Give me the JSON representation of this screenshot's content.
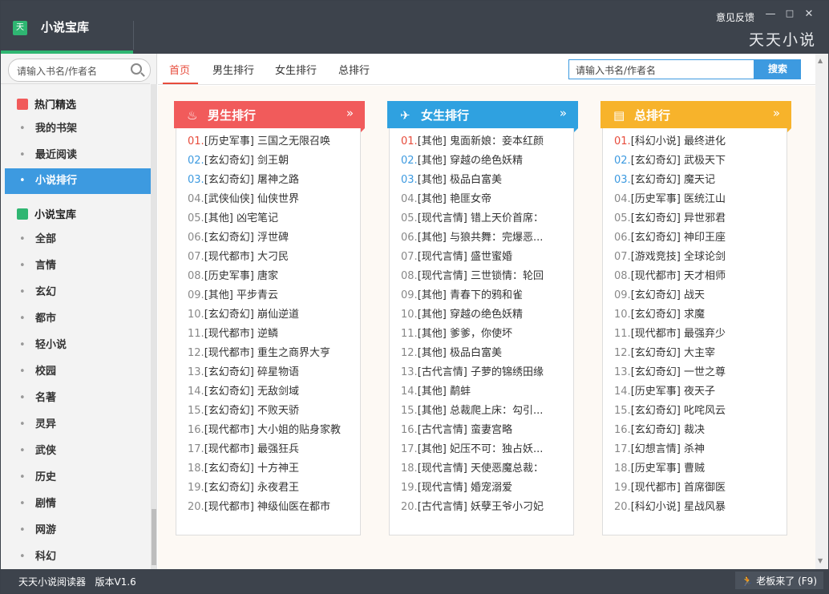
{
  "titlebar": {
    "logo": "天",
    "title": "小说宝库",
    "feedback": "意见反馈",
    "minimize": "—",
    "maximize": "□",
    "close": "✕",
    "brand": "天天小说"
  },
  "sidebar": {
    "search_placeholder": "请输入书名/作者名",
    "section1": "热门精选",
    "items1": [
      "我的书架",
      "最近阅读",
      "小说排行"
    ],
    "section2": "小说宝库",
    "items2": [
      "全部",
      "言情",
      "玄幻",
      "都市",
      "轻小说",
      "校园",
      "名著",
      "灵异",
      "武侠",
      "历史",
      "剧情",
      "网游",
      "科幻"
    ]
  },
  "topnav": {
    "tabs": [
      "首页",
      "男生排行",
      "女生排行",
      "总排行"
    ],
    "search_placeholder": "请输入书名/作者名",
    "search_button": "搜索"
  },
  "panels": [
    {
      "title": "男生排行",
      "chev": "»",
      "color": "#f15b5b",
      "items": [
        "[历史军事] 三国之无限召唤",
        "[玄幻奇幻] 剑王朝",
        "[玄幻奇幻] 屠神之路",
        "[武侠仙侠] 仙侠世界",
        "[其他] 凶宅笔记",
        "[玄幻奇幻] 浮世碑",
        "[现代都市] 大刁民",
        "[历史军事] 唐家",
        "[其他] 平步青云",
        "[玄幻奇幻] 崩仙逆道",
        "[现代都市] 逆鳞",
        "[现代都市] 重生之商界大亨",
        "[玄幻奇幻] 碎星物语",
        "[玄幻奇幻] 无敌剑域",
        "[玄幻奇幻] 不败天骄",
        "[现代都市] 大小姐的贴身家教",
        "[现代都市] 最强狂兵",
        "[玄幻奇幻] 十方神王",
        "[玄幻奇幻] 永夜君王",
        "[现代都市] 神级仙医在都市"
      ]
    },
    {
      "title": "女生排行",
      "chev": "»",
      "color": "#2fa1e0",
      "items": [
        "[其他] 鬼面新娘：妾本红颜",
        "[其他] 穿越の绝色妖精",
        "[其他] 极品白富美",
        "[其他] 艳匪女帝",
        "[现代言情] 错上天价首席：",
        "[其他] 与狼共舞：完爆恶...",
        "[现代言情] 盛世蜜婚",
        "[现代言情] 三世锁情：轮回",
        "[其他] 青春下的鸦和雀",
        "[其他] 穿越の绝色妖精",
        "[其他] 爹爹，你使坏",
        "[其他] 极品白富美",
        "[古代言情] 子萝的锦绣田缘",
        "[其他] 鹬蚌",
        "[其他] 总裁爬上床：勾引...",
        "[古代言情] 蛮妻宫略",
        "[其他] 妃压不可：独占妖...",
        "[现代言情] 天使恶魔总裁：",
        "[现代言情] 婚宠溺爱",
        "[古代言情] 妖孽王爷小刁妃"
      ]
    },
    {
      "title": "总排行",
      "chev": "»",
      "color": "#f7b32b",
      "items": [
        "[科幻小说] 最终进化",
        "[玄幻奇幻] 武极天下",
        "[玄幻奇幻] 魔天记",
        "[历史军事] 医统江山",
        "[玄幻奇幻] 异世邪君",
        "[玄幻奇幻] 神印王座",
        "[游戏竞技] 全球论剑",
        "[现代都市] 天才相师",
        "[玄幻奇幻] 战天",
        "[玄幻奇幻] 求魔",
        "[现代都市] 最强弃少",
        "[玄幻奇幻] 大主宰",
        "[玄幻奇幻] 一世之尊",
        "[历史军事] 夜天子",
        "[玄幻奇幻] 叱咤风云",
        "[玄幻奇幻] 裁决",
        "[幻想言情] 杀神",
        "[历史军事] 曹贼",
        "[现代都市] 首席御医",
        "[科幻小说] 星战风暴"
      ]
    }
  ],
  "statusbar": {
    "app": "天天小说阅读器",
    "version": "版本V1.6",
    "boss": "老板来了 (F9)"
  }
}
